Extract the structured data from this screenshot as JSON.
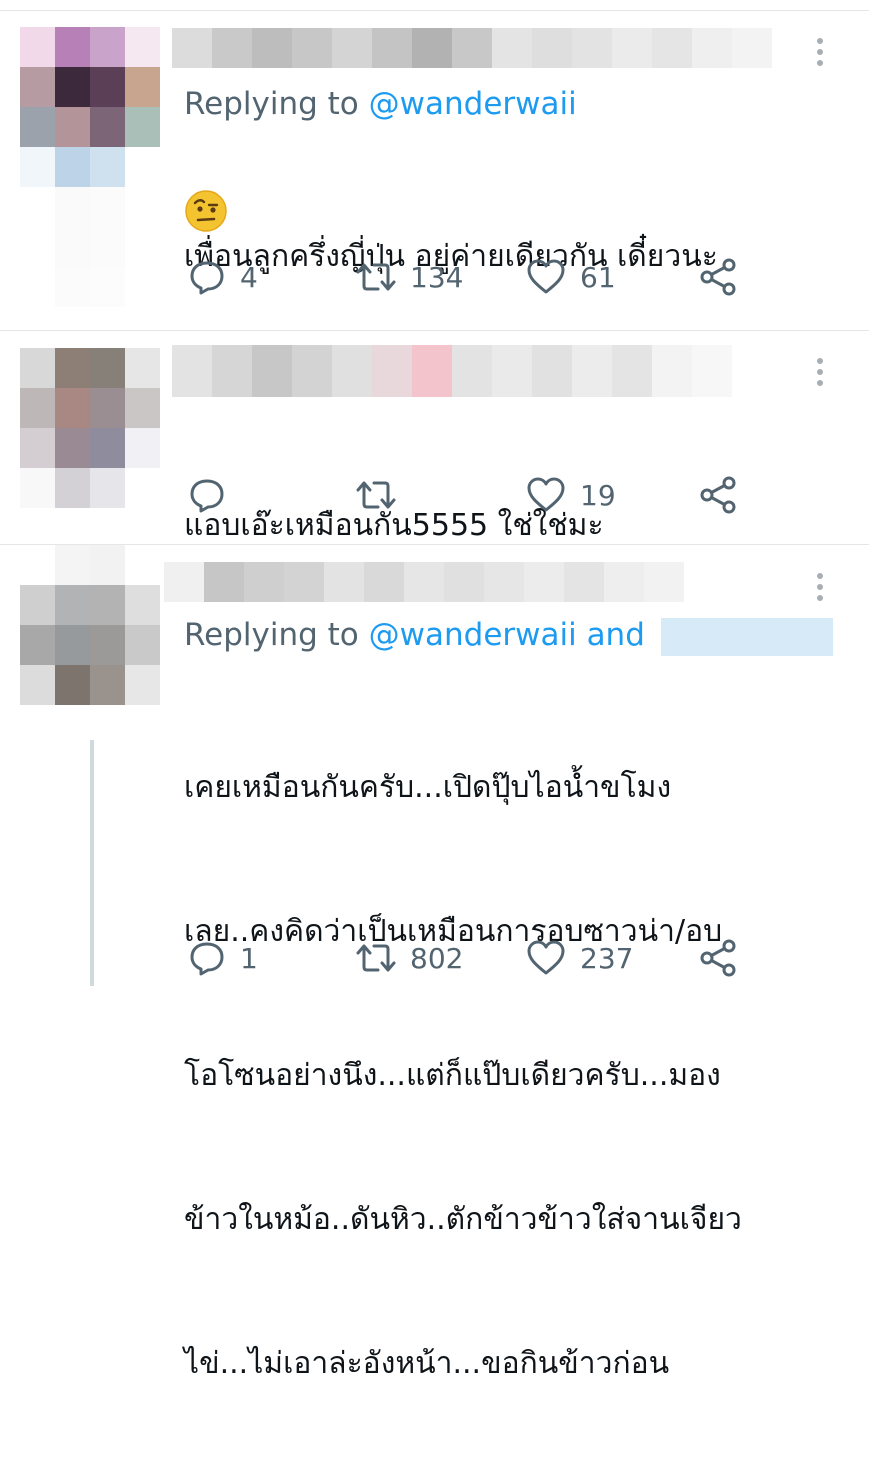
{
  "tweets": [
    {
      "replying_prefix": "Replying to",
      "replying_handle": "@wanderwaii",
      "text_lines": [
        "เพื่อนลูกครึ่งญี่ปุ่น อยู่ค่ายเดียวกัน เดี๋ยวนะ"
      ],
      "emoji": "face-with-raised-eyebrow",
      "reply_count": "4",
      "retweet_count": "134",
      "like_count": "61"
    },
    {
      "text_lines": [
        "แอบเอ๊ะเหมือนกัน5555 ใช่ใช่มะ"
      ],
      "reply_count": "",
      "retweet_count": "",
      "like_count": "19"
    },
    {
      "replying_prefix": "Replying to",
      "replying_handle": "@wanderwaii and",
      "text_lines": [
        "เคยเหมือนกันครับ...เปิดปุ๊บไอน้ำขโมง",
        "เลย..คงคิดว่าเป็นเหมือนการอบซาวน่า/อบ",
        "โอโซนอย่างนึง...แต่ก็แป๊บเดียวครับ...มอง",
        "ข้าวในหม้อ..ดันหิว..ตักข้าวข้าวใส่จานเจียว",
        "ไข่...ไม่เอาล่ะอังหน้า...ขอกินข้าวก่อน"
      ],
      "reply_count": "1",
      "retweet_count": "802",
      "like_count": "237"
    }
  ],
  "icons": {
    "reply": "reply-icon",
    "retweet": "retweet-icon",
    "like": "heart-icon",
    "share": "share-icon",
    "more": "more-options-icon"
  },
  "colors": {
    "muted": "#536471",
    "accent": "#1d9bf0",
    "divider": "#e6e6e6",
    "thread_line": "#cfd9de"
  }
}
